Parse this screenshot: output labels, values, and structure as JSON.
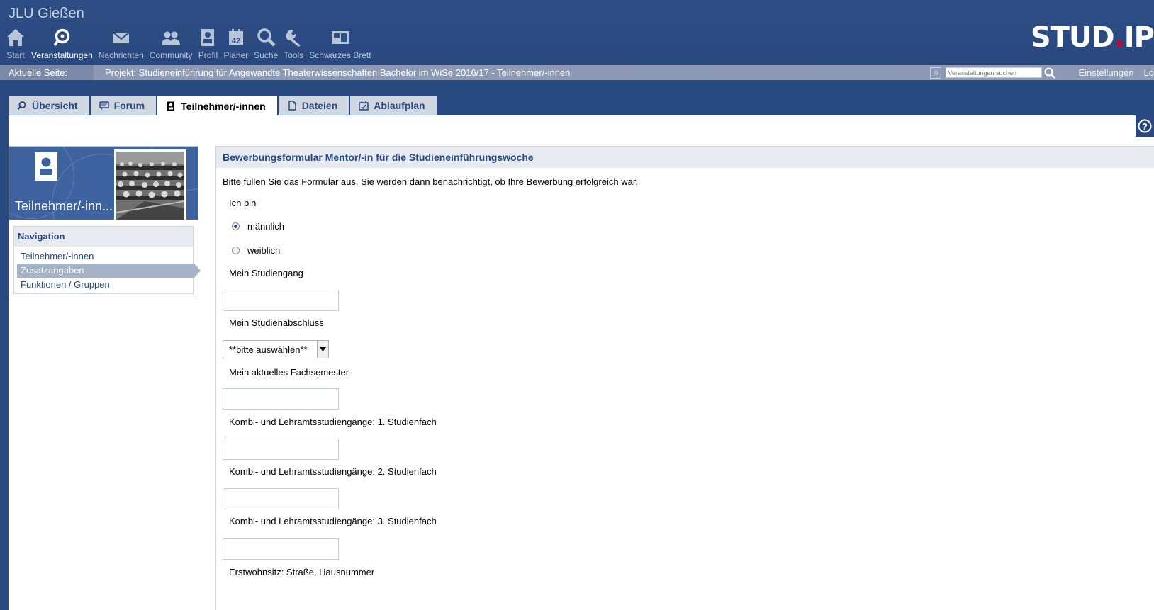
{
  "header": {
    "university": "JLU Gießen",
    "logo_text": "STUD",
    "logo_dot": ".",
    "logo_ip": "IP",
    "nav": [
      {
        "label": "Start",
        "icon": "home-icon"
      },
      {
        "label": "Veranstaltungen",
        "icon": "courses-icon",
        "active": true
      },
      {
        "label": "Nachrichten",
        "icon": "mail-icon"
      },
      {
        "label": "Community",
        "icon": "community-icon"
      },
      {
        "label": "Profil",
        "icon": "profile-icon"
      },
      {
        "label": "Planer",
        "icon": "calendar-icon",
        "calendar_day": "42"
      },
      {
        "label": "Suche",
        "icon": "search-icon"
      },
      {
        "label": "Tools",
        "icon": "wrench-icon"
      },
      {
        "label": "Schwarzes Brett",
        "icon": "board-icon"
      }
    ]
  },
  "breadcrumb": {
    "label": "Aktuelle Seite:",
    "text": "Projekt: Studieneinführung für Angewandte Theaterwissenschaften Bachelor im WiSe 2016/17 - Teilnehmer/-innen",
    "count": "0",
    "search_placeholder": "Veranstaltungen suchen",
    "settings": "Einstellungen",
    "logout": "Lo"
  },
  "tabs": [
    {
      "label": "Übersicht",
      "icon": "overview-icon"
    },
    {
      "label": "Forum",
      "icon": "forum-icon"
    },
    {
      "label": "Teilnehmer/-innen",
      "icon": "participants-icon",
      "active": true
    },
    {
      "label": "Dateien",
      "icon": "files-icon"
    },
    {
      "label": "Ablaufplan",
      "icon": "schedule-icon"
    }
  ],
  "sidebar": {
    "title": "Teilnehmer/-inn...",
    "nav_heading": "Navigation",
    "links": [
      "Teilnehmer/-innen",
      "Zusatzangaben",
      "Funktionen / Gruppen"
    ],
    "selected_index": 1
  },
  "form": {
    "heading": "Bewerbungsformular Mentor/-in für die Studieneinführungswoche",
    "intro": "Bitte füllen Sie das Formular aus. Sie werden dann benachrichtigt, ob Ihre Bewerbung erfolgreich war.",
    "gender_label": "Ich bin",
    "gender_options": [
      "männlich",
      "weiblich"
    ],
    "gender_selected": "männlich",
    "studiengang_label": "Mein Studiengang",
    "studiengang_value": "",
    "abschluss_label": "Mein Studienabschluss",
    "abschluss_value": "**bitte auswählen**",
    "fachsemester_label": "Mein aktuelles Fachsemester",
    "fachsemester_value": "",
    "fach1_label": "Kombi- und Lehramtsstudiengänge: 1. Studienfach",
    "fach2_label": "Kombi- und Lehramtsstudiengänge: 2. Studienfach",
    "fach3_label": "Kombi- und Lehramtsstudiengänge: 3. Studienfach",
    "wohnsitz_label": "Erstwohnsitz: Straße, Hausnummer"
  },
  "colors": {
    "header": "#28497f",
    "breadcrumb": "#8c9ab5",
    "tab": "#d1d7e1",
    "accent_red": "#d6001c"
  }
}
